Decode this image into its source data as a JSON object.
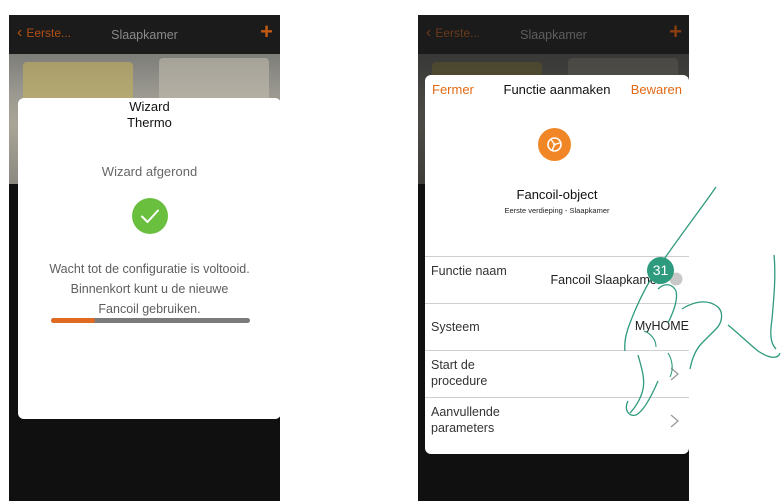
{
  "left_screen": {
    "topbar": {
      "back": "Eerste...",
      "title": "Slaapkamer",
      "plus": "+"
    },
    "dialog": {
      "title": "Wizard",
      "subtitle": "Thermo",
      "status": "Wizard afgerond",
      "message": [
        "Wacht tot de configuratie is voltooid.",
        "Binnenkort kunt u de nieuwe",
        "Fancoil gebruiken."
      ],
      "progress": 0.22
    }
  },
  "right_screen": {
    "topbar": {
      "back": "Eerste...",
      "title": "Slaapkamer",
      "plus": "+"
    },
    "card": {
      "close": "Fermer",
      "title": "Functie aanmaken",
      "save": "Bewaren",
      "object_title": "Fancoil-object",
      "object_location": "Eerste verdieping - Slaapkamer",
      "rows": [
        {
          "label": "Functie naam",
          "value": "Fancoil Slaapkamer"
        },
        {
          "label": "Systeem",
          "value": "MyHOME"
        },
        {
          "label": "Start de procedure",
          "value": ""
        },
        {
          "label": "Aanvullende parameters",
          "value": ""
        }
      ]
    }
  },
  "step_badge": "31",
  "colors": {
    "accent": "#e06a16",
    "check": "#6bbf3e",
    "badge": "#2e9a7e"
  }
}
